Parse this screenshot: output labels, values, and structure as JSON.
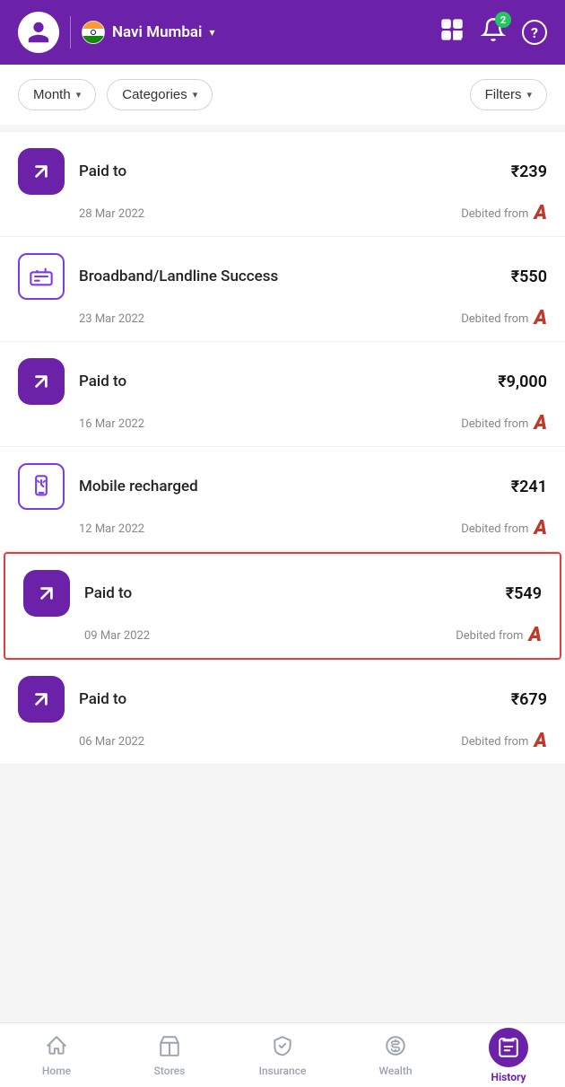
{
  "header": {
    "location": "Navi Mumbai",
    "notification_count": "2",
    "avatar_icon": "user-icon"
  },
  "filters": {
    "month_label": "Month",
    "categories_label": "Categories",
    "filters_label": "Filters"
  },
  "transactions": [
    {
      "id": "tx1",
      "type": "paid",
      "icon": "arrow-up-right-icon",
      "title": "Paid to",
      "amount": "₹239",
      "date": "28 Mar 2022",
      "debit_label": "Debited from",
      "highlighted": false
    },
    {
      "id": "tx2",
      "type": "broadband",
      "icon": "router-icon",
      "title": "Broadband/Landline Success",
      "amount": "₹550",
      "date": "23 Mar 2022",
      "debit_label": "Debited from",
      "highlighted": false
    },
    {
      "id": "tx3",
      "type": "paid",
      "icon": "arrow-up-right-icon",
      "title": "Paid to",
      "amount": "₹9,000",
      "date": "16 Mar 2022",
      "debit_label": "Debited from",
      "highlighted": false
    },
    {
      "id": "tx4",
      "type": "mobile",
      "icon": "mobile-icon",
      "title": "Mobile recharged",
      "amount": "₹241",
      "date": "12 Mar 2022",
      "debit_label": "Debited from",
      "highlighted": false
    },
    {
      "id": "tx5",
      "type": "paid",
      "icon": "arrow-up-right-icon",
      "title": "Paid to",
      "amount": "₹549",
      "date": "09 Mar 2022",
      "debit_label": "Debited from",
      "highlighted": true
    },
    {
      "id": "tx6",
      "type": "paid",
      "icon": "arrow-up-right-icon",
      "title": "Paid to",
      "amount": "₹679",
      "date": "06 Mar 2022",
      "debit_label": "Debited from",
      "highlighted": false
    }
  ],
  "bottom_nav": {
    "items": [
      {
        "id": "home",
        "label": "Home",
        "active": false
      },
      {
        "id": "stores",
        "label": "Stores",
        "active": false
      },
      {
        "id": "insurance",
        "label": "Insurance",
        "active": false
      },
      {
        "id": "wealth",
        "label": "Wealth",
        "active": false
      },
      {
        "id": "history",
        "label": "History",
        "active": true
      }
    ]
  }
}
